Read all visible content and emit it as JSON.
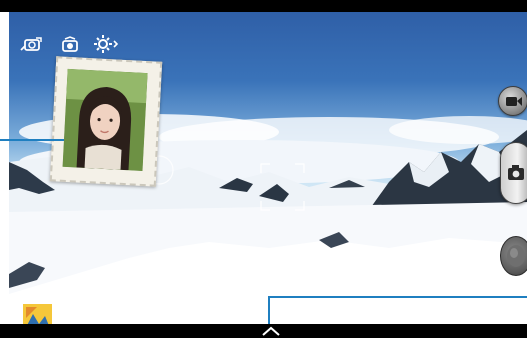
{
  "top_left_icons": [
    {
      "name": "self-portrait-mode-icon"
    },
    {
      "name": "camera-switch-icon"
    },
    {
      "name": "settings-icon"
    }
  ],
  "right_controls": {
    "record_video": {
      "name": "video-camera-icon"
    },
    "shutter": {
      "name": "camera-icon"
    },
    "mode": {
      "name": "mode-dial-icon"
    }
  },
  "picture_in_picture": {
    "label": "",
    "icon": "dual-camera-frame"
  },
  "gallery_thumbnail": {
    "name": "gallery-thumbnail"
  },
  "expand_handle": {
    "name": "chevron-up-icon"
  },
  "colors": {
    "callout": "#1f7fc0",
    "sky_top": "#2f5fa7",
    "snow": "#f6f9fd"
  }
}
